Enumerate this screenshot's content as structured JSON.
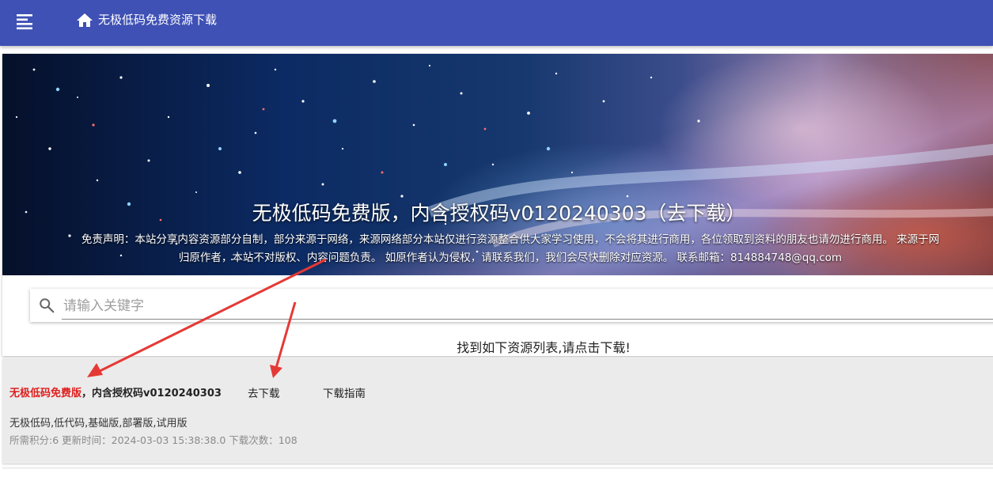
{
  "appbar": {
    "title": "无极低码免费资源下载",
    "menu_icon": "hamburger-menu-icon",
    "home_icon": "home-icon",
    "background": "#3f51b5"
  },
  "banner": {
    "title": "无极低码免费版，内含授权码v0120240303（去下载）",
    "disclaimer_line1": "免责声明：本站分享内容资源部分自制，部分来源于网络，来源网络部分本站仅进行资源整合供大家学习使用，不会将其进行商用，各位领取到资料的朋友也请勿进行商用。 来源于网",
    "disclaimer_line2": "归原作者，本站不对版权、内容问题负责。 如原作者认为侵权，请联系我们，我们会尽快删除对应资源。 联系邮箱：814884748@qq.com"
  },
  "search": {
    "placeholder": "请输入关键字",
    "value": "",
    "icon": "search-icon"
  },
  "results": {
    "heading": "找到如下资源列表,请点击下载!",
    "items": [
      {
        "title_highlight": "无极低码免费版",
        "title_rest": "，内含授权码v0120240303",
        "download_label": "去下载",
        "guide_label": "下载指南",
        "tags": "无极低码,低代码,基础版,部署版,试用版",
        "meta": "所需积分:6 更新时间：2024-03-03 15:38:38.0 下载次数：108"
      }
    ]
  },
  "colors": {
    "highlight": "#e01e1e",
    "annotation_arrow": "#e53935",
    "result_background": "#ebebeb"
  }
}
